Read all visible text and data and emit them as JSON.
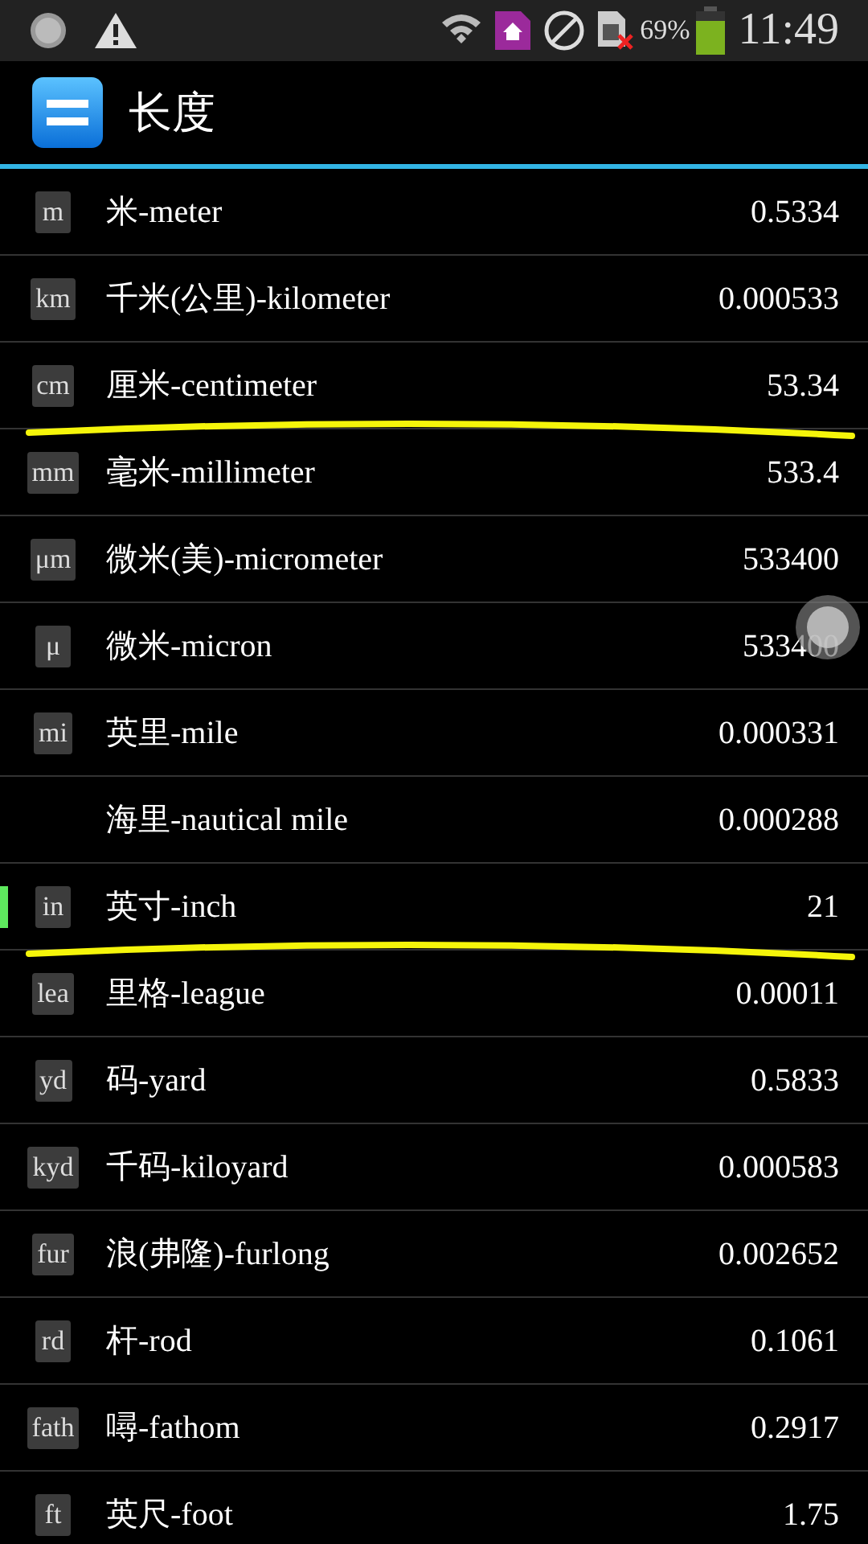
{
  "status_bar": {
    "battery": "69%",
    "time": "11:49"
  },
  "title": "长度",
  "units": [
    {
      "badge": "m",
      "name": "米-meter",
      "value": "0.5334",
      "selected": false,
      "underlined": false
    },
    {
      "badge": "km",
      "name": "千米(公里)-kilometer",
      "value": "0.000533",
      "selected": false,
      "underlined": false
    },
    {
      "badge": "cm",
      "name": "厘米-centimeter",
      "value": "53.34",
      "selected": false,
      "underlined": true
    },
    {
      "badge": "mm",
      "name": "毫米-millimeter",
      "value": "533.4",
      "selected": false,
      "underlined": false
    },
    {
      "badge": "μm",
      "name": "微米(美)-micrometer",
      "value": "533400",
      "selected": false,
      "underlined": false
    },
    {
      "badge": "μ",
      "name": "微米-micron",
      "value": "533400",
      "selected": false,
      "underlined": false
    },
    {
      "badge": "mi",
      "name": "英里-mile",
      "value": "0.000331",
      "selected": false,
      "underlined": false
    },
    {
      "name": "海里-nautical mile",
      "value": "0.000288",
      "selected": false,
      "underlined": false
    },
    {
      "badge": "in",
      "name": "英寸-inch",
      "value": "21",
      "selected": true,
      "underlined": true
    },
    {
      "badge": "lea",
      "name": "里格-league",
      "value": "0.00011",
      "selected": false,
      "underlined": false
    },
    {
      "badge": "yd",
      "name": "码-yard",
      "value": "0.5833",
      "selected": false,
      "underlined": false
    },
    {
      "badge": "kyd",
      "name": "千码-kiloyard",
      "value": "0.000583",
      "selected": false,
      "underlined": false
    },
    {
      "badge": "fur",
      "name": "浪(弗隆)-furlong",
      "value": "0.002652",
      "selected": false,
      "underlined": false
    },
    {
      "badge": "rd",
      "name": "杆-rod",
      "value": "0.1061",
      "selected": false,
      "underlined": false
    },
    {
      "badge": "fath",
      "name": "噚-fathom",
      "value": "0.2917",
      "selected": false,
      "underlined": false
    },
    {
      "badge": "ft",
      "name": "英尺-foot",
      "value": "1.75",
      "selected": false,
      "underlined": false
    }
  ]
}
